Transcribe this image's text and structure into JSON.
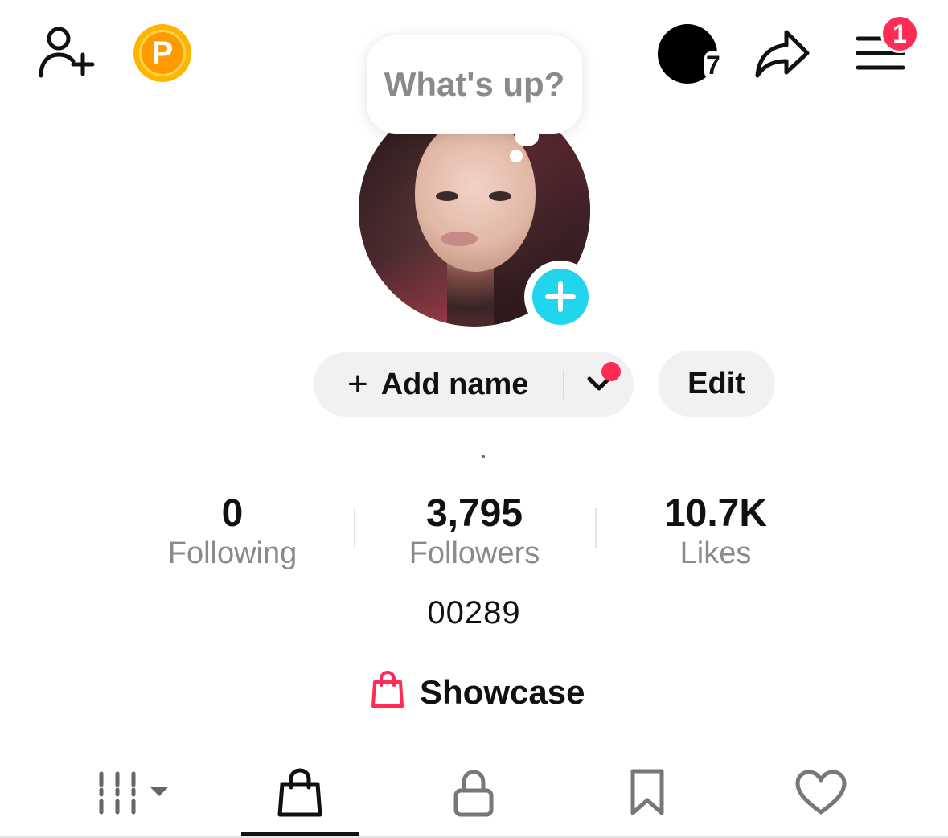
{
  "header": {
    "coin_label": "P",
    "story_count": "7",
    "menu_badge_count": "1",
    "colors": {
      "coin": "#FFB400",
      "badge": "#FE2C55"
    }
  },
  "profile": {
    "bubble_text": "What's up?",
    "add_name_label": "Add name",
    "add_name_icon": "+",
    "edit_label": "Edit",
    "accent_color": "#20D5EC"
  },
  "stats": [
    {
      "value": "0",
      "label": "Following"
    },
    {
      "value": "3,795",
      "label": "Followers"
    },
    {
      "value": "10.7K",
      "label": "Likes"
    }
  ],
  "bio": "00289",
  "showcase": {
    "label": "Showcase",
    "icon": "shopping-bag-icon",
    "color": "#FE2C55"
  },
  "tabs": [
    {
      "icon": "videos-grid-icon",
      "active": false
    },
    {
      "icon": "shopping-bag-icon",
      "active": true
    },
    {
      "icon": "lock-icon",
      "active": false
    },
    {
      "icon": "bookmark-icon",
      "active": false
    },
    {
      "icon": "heart-icon",
      "active": false
    }
  ]
}
